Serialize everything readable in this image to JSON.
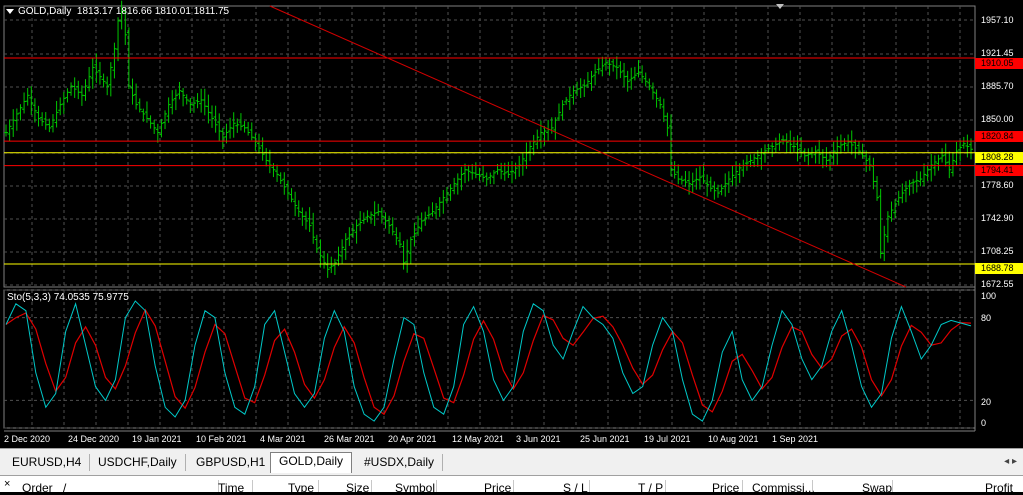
{
  "chart": {
    "title": "GOLD,Daily",
    "ohlc": "1813.17 1816.66 1810.01 1811.75",
    "indicator_label": "Sto(5,3,3) 74.0535 75.9775",
    "colors": {
      "background": "#000000",
      "bars": "#00c800",
      "grid": "#505050",
      "hline_red": "#ff0000",
      "hline_yellow": "#ffff00",
      "trendline": "#d00000",
      "sto_main": "#00c8c8",
      "sto_signal": "#e00000"
    },
    "y_labels": [
      "1957.10",
      "1921.45",
      "1885.70",
      "1850.00",
      "1778.60",
      "1742.90",
      "1708.25",
      "1672.55"
    ],
    "hlines": [
      {
        "price_label": "1910.05",
        "color": "#ff0000"
      },
      {
        "price_label": "1820.84",
        "color": "#ff0000"
      },
      {
        "price_label": "1808.28",
        "color": "#ffff00"
      },
      {
        "price_label": "1794.41",
        "color": "#ff0000"
      },
      {
        "price_label": "1688.78",
        "color": "#ffff00"
      }
    ],
    "sto_levels": [
      "100",
      "80",
      "20",
      "0"
    ],
    "x_labels": [
      "2 Dec 2020",
      "24 Dec 2020",
      "19 Jan 2021",
      "10 Feb 2021",
      "4 Mar 2021",
      "26 Mar 2021",
      "20 Apr 2021",
      "12 May 2021",
      "3 Jun 2021",
      "25 Jun 2021",
      "19 Jul 2021",
      "10 Aug 2021",
      "1 Sep 2021"
    ]
  },
  "chart_data": {
    "type": "candlestick-ohlc",
    "symbol": "GOLD",
    "timeframe": "Daily",
    "ylim": [
      1664,
      1966
    ],
    "price_path": [
      [
        0,
        1830
      ],
      [
        3,
        1850
      ],
      [
        6,
        1870
      ],
      [
        9,
        1845
      ],
      [
        12,
        1835
      ],
      [
        15,
        1860
      ],
      [
        18,
        1880
      ],
      [
        21,
        1870
      ],
      [
        24,
        1900
      ],
      [
        26,
        1890
      ],
      [
        28,
        1880
      ],
      [
        30,
        1920
      ],
      [
        31,
        1950
      ],
      [
        32,
        1960
      ],
      [
        33,
        1935
      ],
      [
        34,
        1880
      ],
      [
        36,
        1860
      ],
      [
        39,
        1845
      ],
      [
        42,
        1830
      ],
      [
        45,
        1860
      ],
      [
        48,
        1875
      ],
      [
        51,
        1860
      ],
      [
        54,
        1865
      ],
      [
        57,
        1845
      ],
      [
        60,
        1825
      ],
      [
        63,
        1840
      ],
      [
        66,
        1835
      ],
      [
        69,
        1820
      ],
      [
        72,
        1800
      ],
      [
        75,
        1785
      ],
      [
        78,
        1765
      ],
      [
        81,
        1745
      ],
      [
        84,
        1730
      ],
      [
        86,
        1705
      ],
      [
        88,
        1690
      ],
      [
        89,
        1683
      ],
      [
        91,
        1690
      ],
      [
        94,
        1715
      ],
      [
        97,
        1730
      ],
      [
        100,
        1740
      ],
      [
        103,
        1745
      ],
      [
        106,
        1730
      ],
      [
        109,
        1710
      ],
      [
        110,
        1690
      ],
      [
        112,
        1715
      ],
      [
        115,
        1735
      ],
      [
        118,
        1745
      ],
      [
        121,
        1760
      ],
      [
        124,
        1775
      ],
      [
        127,
        1790
      ],
      [
        130,
        1785
      ],
      [
        133,
        1780
      ],
      [
        136,
        1790
      ],
      [
        139,
        1785
      ],
      [
        142,
        1795
      ],
      [
        145,
        1815
      ],
      [
        148,
        1830
      ],
      [
        151,
        1835
      ],
      [
        154,
        1860
      ],
      [
        157,
        1875
      ],
      [
        160,
        1880
      ],
      [
        163,
        1895
      ],
      [
        166,
        1905
      ],
      [
        169,
        1900
      ],
      [
        172,
        1885
      ],
      [
        175,
        1895
      ],
      [
        178,
        1880
      ],
      [
        181,
        1860
      ],
      [
        183,
        1835
      ],
      [
        184,
        1790
      ],
      [
        186,
        1780
      ],
      [
        189,
        1775
      ],
      [
        192,
        1782
      ],
      [
        195,
        1770
      ],
      [
        197,
        1765
      ],
      [
        200,
        1780
      ],
      [
        203,
        1792
      ],
      [
        206,
        1800
      ],
      [
        209,
        1808
      ],
      [
        212,
        1815
      ],
      [
        215,
        1822
      ],
      [
        218,
        1815
      ],
      [
        221,
        1805
      ],
      [
        224,
        1810
      ],
      [
        227,
        1800
      ],
      [
        230,
        1815
      ],
      [
        233,
        1820
      ],
      [
        236,
        1810
      ],
      [
        239,
        1795
      ],
      [
        241,
        1760
      ],
      [
        242,
        1700
      ],
      [
        244,
        1740
      ],
      [
        247,
        1760
      ],
      [
        250,
        1775
      ],
      [
        253,
        1780
      ],
      [
        256,
        1795
      ],
      [
        259,
        1805
      ],
      [
        261,
        1790
      ],
      [
        263,
        1810
      ],
      [
        265,
        1818
      ],
      [
        267,
        1812
      ]
    ],
    "hlines_price": [
      1910.05,
      1820.84,
      1808.28,
      1794.41,
      1688.78
    ],
    "trendline": {
      "from": [
        73,
        1966
      ],
      "to": [
        249,
        1664
      ]
    },
    "stochastic": {
      "params": "5,3,3",
      "main_last": 74.0535,
      "signal_last": 75.9775,
      "levels": [
        0,
        20,
        80,
        100
      ],
      "main": [
        75,
        90,
        85,
        40,
        15,
        25,
        70,
        90,
        60,
        30,
        20,
        35,
        80,
        92,
        85,
        45,
        15,
        8,
        20,
        60,
        85,
        80,
        40,
        15,
        10,
        30,
        75,
        85,
        55,
        25,
        15,
        25,
        65,
        85,
        70,
        30,
        10,
        5,
        15,
        50,
        80,
        75,
        40,
        15,
        10,
        30,
        75,
        88,
        70,
        35,
        20,
        30,
        70,
        90,
        85,
        60,
        50,
        70,
        88,
        80,
        75,
        65,
        40,
        25,
        30,
        60,
        80,
        70,
        35,
        10,
        5,
        20,
        55,
        70,
        35,
        20,
        30,
        60,
        85,
        75,
        50,
        35,
        45,
        70,
        85,
        60,
        30,
        15,
        25,
        65,
        88,
        70,
        50,
        60,
        75,
        78,
        76,
        74
      ]
    }
  },
  "tabs": [
    {
      "label": "EURUSD,H4",
      "active": false
    },
    {
      "label": "USDCHF,Daily",
      "active": false
    },
    {
      "label": "GBPUSD,H1",
      "active": false
    },
    {
      "label": "GOLD,Daily",
      "active": true
    },
    {
      "label": "#USDX,Daily",
      "active": false
    }
  ],
  "tab_scroll": "◂ ▸",
  "terminal": {
    "close_glyph": "×",
    "columns": [
      "Order",
      "/",
      "Time",
      "Type",
      "Size",
      "Symbol",
      "Price",
      "S / L",
      "T / P",
      "Price",
      "Commissi...",
      "Swap",
      "Profit"
    ]
  }
}
